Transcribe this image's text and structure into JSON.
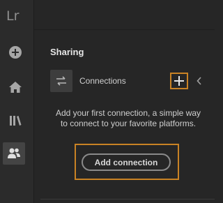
{
  "app": {
    "logo_text": "Lr"
  },
  "rail": {
    "items": [
      {
        "icon": "add-circle-icon"
      },
      {
        "icon": "home-icon"
      },
      {
        "icon": "library-icon"
      },
      {
        "icon": "sharing-people-icon",
        "active": true
      }
    ]
  },
  "sharing": {
    "title": "Sharing",
    "connections_label": "Connections",
    "empty_hint": "Add your first connection, a simple way to connect to your favorite platforms.",
    "add_connection_label": "Add connection"
  },
  "colors": {
    "highlight": "#c98224",
    "background": "#262626"
  }
}
